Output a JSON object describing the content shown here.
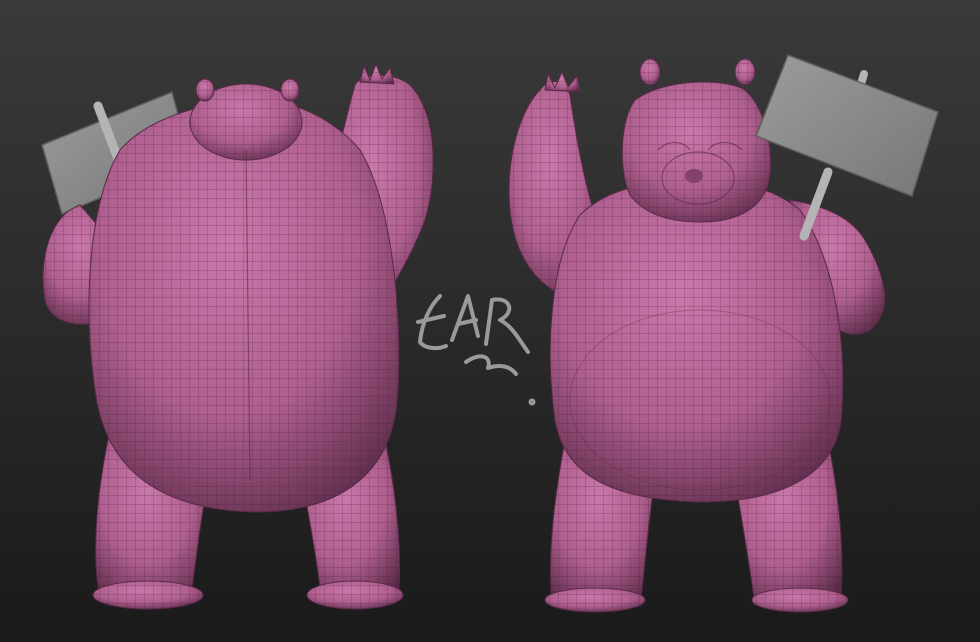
{
  "scene": {
    "background_top": "#3a3a3a",
    "background_bottom": "#1a1a1a",
    "mesh_color": "#b0608f",
    "mesh_highlight": "#c978aa",
    "mesh_shadow": "#5a2a48",
    "wire_color": "#3d1a30",
    "sign_color": "#8a8a8a",
    "sign_edge": "#5e5e5e",
    "pole_color": "#9a9a9a"
  },
  "models": [
    {
      "name": "hippo-back-view",
      "view": "back"
    },
    {
      "name": "hippo-front-view",
      "view": "front"
    }
  ],
  "signature": {
    "text": "EAR",
    "color": "#9a9a9a",
    "kind": "handwritten"
  }
}
